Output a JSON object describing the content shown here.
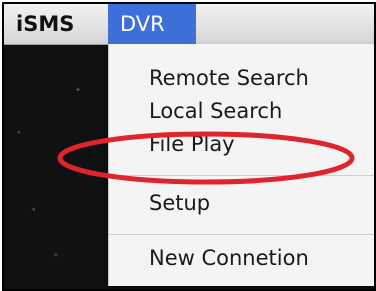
{
  "menubar": {
    "app_name": "iSMS",
    "active_menu": "DVR"
  },
  "dropdown": {
    "items": [
      {
        "label": "Remote Search"
      },
      {
        "label": "Local Search"
      },
      {
        "label": "File Play"
      },
      {
        "label": "Setup"
      },
      {
        "label": "New Connetion"
      }
    ]
  },
  "colors": {
    "menu_highlight": "#3f6fd8",
    "annotation": "#e0242b"
  }
}
